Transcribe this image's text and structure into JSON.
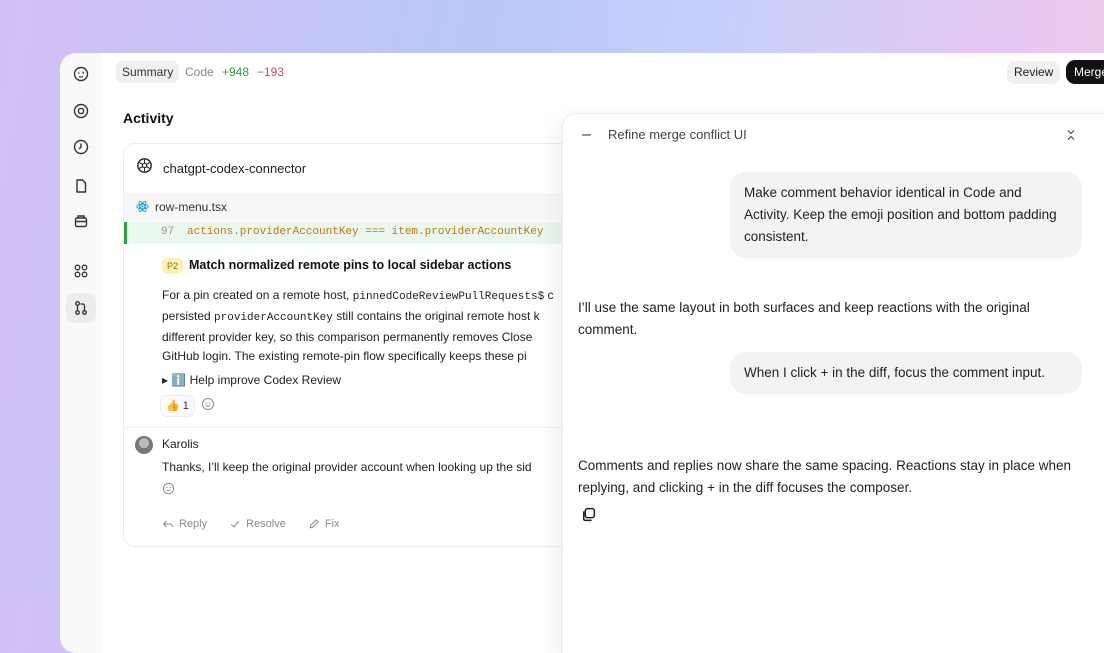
{
  "topbar": {
    "tab_summary": "Summary",
    "tab_code": "Code",
    "additions": "+948",
    "deletions": "−193",
    "review_label": "Review",
    "merge_label": "Merge",
    "more_label": "···"
  },
  "sidebar": {
    "icons": [
      "face-icon",
      "target-icon",
      "clock-icon",
      "document-icon",
      "package-icon",
      "apps-icon",
      "pull-request-icon"
    ],
    "active": "pull-request-icon"
  },
  "activity": {
    "title": "Activity",
    "author": "chatgpt-codex-connector",
    "file": "row-menu.tsx",
    "line_number": "97",
    "code": "actions.providerAccountKey === item.providerAccountKey",
    "priority": "P2",
    "issue_title": "Match normalized remote pins to local sidebar actions",
    "issue_body": [
      {
        "t": "For a pin created on a remote host, ",
        "m": false
      },
      {
        "t": "pinnedCodeReviewPullRequests$",
        "m": true
      },
      {
        "t": " c",
        "m": false
      }
    ],
    "issue_body_2": [
      {
        "t": "persisted ",
        "m": false
      },
      {
        "t": "providerAccountKey",
        "m": true
      },
      {
        "t": " still contains the original remote host k",
        "m": false
      }
    ],
    "issue_body_3": "different provider key, so this comparison permanently removes Close",
    "issue_body_4": "GitHub login. The existing remote-pin flow specifically keeps these pi",
    "help_text": "▸ ℹ️ Help improve Codex Review",
    "reaction": "👍 1",
    "commenter": "Karolis",
    "reply": "Thanks, I’ll keep the original provider account when looking up the sid",
    "actions": {
      "reply": "Reply",
      "resolve": "Resolve",
      "fix": "Fix"
    }
  },
  "panel": {
    "title": "Refine merge conflict UI",
    "messages": [
      {
        "role": "user",
        "text": "Make comment behavior identical in Code and Activity. Keep the emoji position and bottom padding consistent."
      },
      {
        "role": "assistant",
        "text": "I’ll use the same layout in both surfaces and keep reactions with the original comment."
      },
      {
        "role": "user",
        "text": "When I click + in the diff, focus the comment input."
      },
      {
        "role": "assistant",
        "text": "Comments and replies now share the same spacing. Reactions stay in place when replying, and clicking + in the diff focuses the composer."
      }
    ]
  },
  "colors": {
    "addition": "#2f9e44",
    "deletion": "#d9485f",
    "merge_bg": "#111111",
    "priority_bg": "#fdf0b3"
  }
}
